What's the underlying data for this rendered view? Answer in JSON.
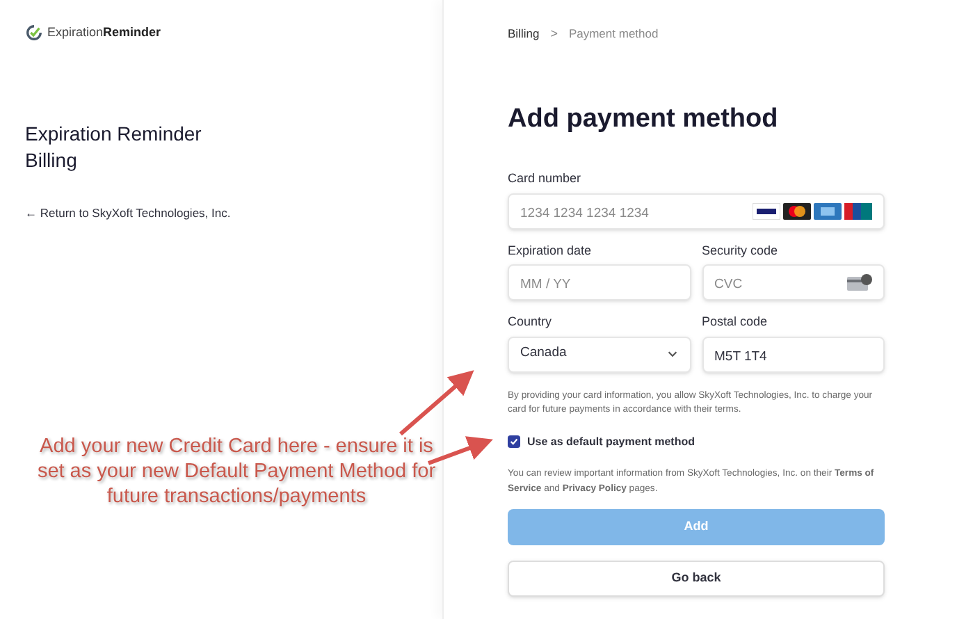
{
  "logo": {
    "text_light": "Expiration",
    "text_bold": "Reminder"
  },
  "sidebar": {
    "title": "Expiration Reminder Billing",
    "back_link": "← Return to SkyXoft Technologies, Inc."
  },
  "breadcrumb": [
    {
      "label": "Billing",
      "selected": false
    },
    {
      "label": "Payment method",
      "selected": true
    }
  ],
  "breadcrumb_separator": ">",
  "heading": "Add payment method",
  "fields": [
    {
      "kind": "card",
      "label": "Card number",
      "placeholder": "1234 1234 1234 1234"
    },
    {
      "kind": "text",
      "label": "Expiration date",
      "placeholder": "MM / YY"
    },
    {
      "kind": "cvc",
      "label": "Security code",
      "placeholder": "CVC"
    },
    {
      "kind": "select",
      "label": "Country",
      "value": "Canada"
    },
    {
      "kind": "text",
      "label": "Postal code",
      "value": "M5T 1T4"
    }
  ],
  "consent": "By providing your card information, you allow SkyXoft Technologies, Inc. to charge your card for future payments in accordance with their terms.",
  "default_checkbox": {
    "label": "Use as default payment method",
    "checked": true
  },
  "terms": "You can review important information from SkyXoft Technologies, Inc. on their **Terms of Service** and **Privacy Policy** pages.",
  "buttons": [
    {
      "kind": "primary",
      "label": "Add",
      "disabled": true
    },
    {
      "kind": "secondary",
      "label": "Go back",
      "disabled": false
    }
  ],
  "annotation": "Add your new Credit Card here - ensure it is set as your new Default Payment Method for future transactions/payments"
}
